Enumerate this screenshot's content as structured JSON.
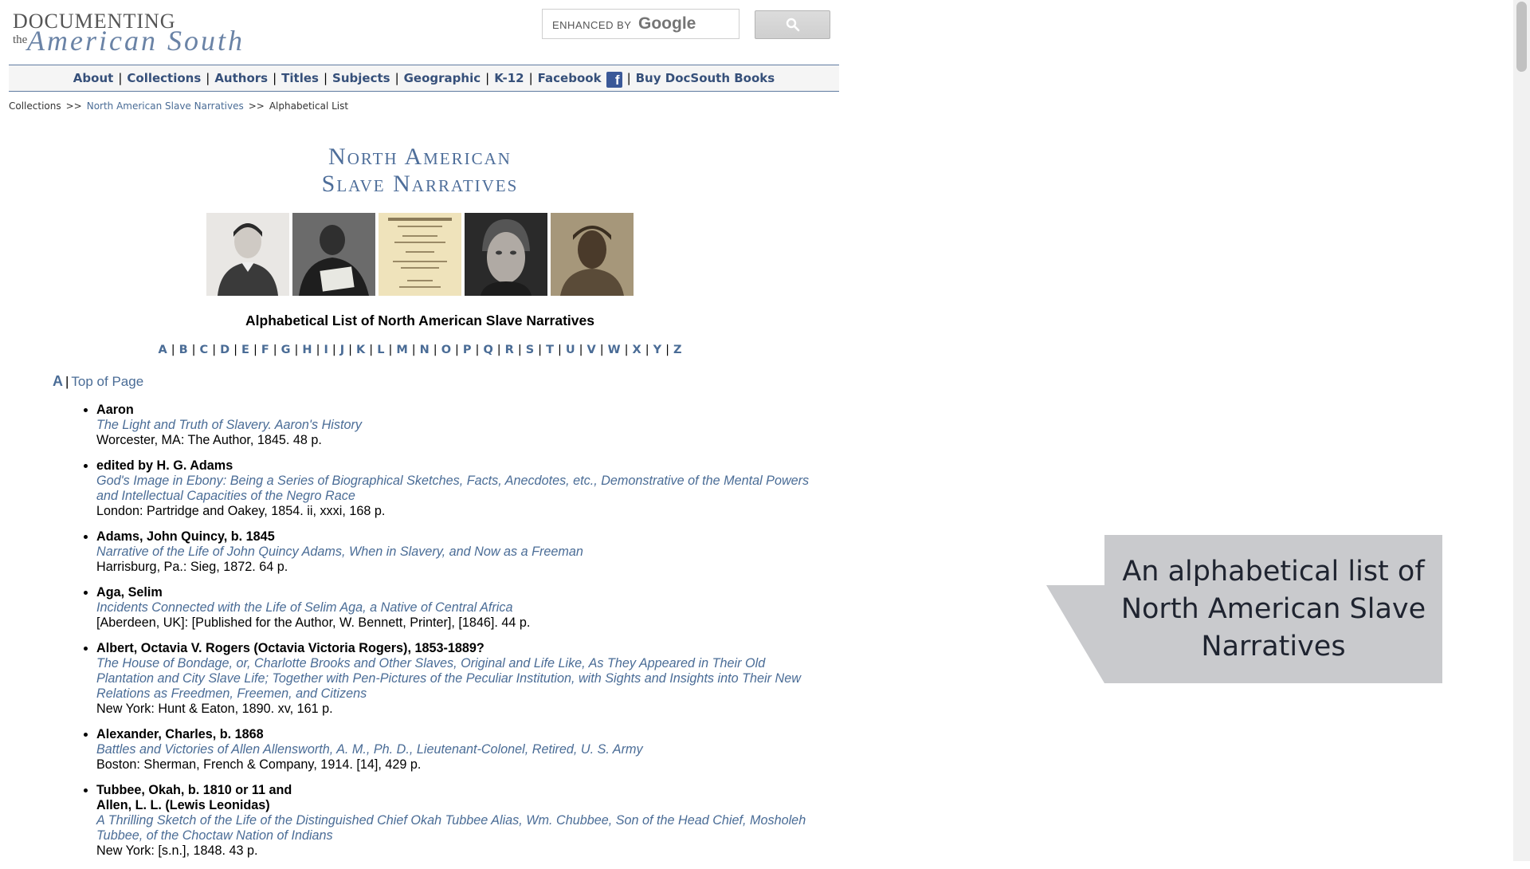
{
  "header": {
    "logo": {
      "top": "DOCUMENTING",
      "the": "the",
      "bottom": "American South"
    },
    "search": {
      "enhanced_label": "ENHANCED BY",
      "google_label": "Google",
      "button_icon": "search-icon"
    }
  },
  "nav": {
    "items": [
      {
        "label": "About"
      },
      {
        "label": "Collections"
      },
      {
        "label": "Authors"
      },
      {
        "label": "Titles"
      },
      {
        "label": "Subjects"
      },
      {
        "label": "Geographic"
      },
      {
        "label": "K-12"
      },
      {
        "label": "Facebook"
      },
      {
        "label": "Buy DocSouth Books"
      }
    ],
    "facebook_icon": "facebook-icon",
    "facebook_glyph": "f"
  },
  "breadcrumb": {
    "items": [
      "Collections",
      "North American Slave Narratives",
      "Alphabetical List"
    ],
    "separator": ">>"
  },
  "collection": {
    "title_line1": "North American",
    "title_line2": "Slave Narratives"
  },
  "list_heading": "Alphabetical List of North American Slave Narratives",
  "alpha_nav": [
    "A",
    "B",
    "C",
    "D",
    "E",
    "F",
    "G",
    "H",
    "I",
    "J",
    "K",
    "L",
    "M",
    "N",
    "O",
    "P",
    "Q",
    "R",
    "S",
    "T",
    "U",
    "V",
    "W",
    "X",
    "Y",
    "Z"
  ],
  "section": {
    "letter": "A",
    "separator": "|",
    "top_link": "Top of Page"
  },
  "entries": [
    {
      "author": "Aaron",
      "title": "The Light and Truth of Slavery. Aaron's History",
      "imprint": "Worcester, MA: The Author, 1845. 48 p."
    },
    {
      "author": "edited by H. G. Adams",
      "title": "God's Image in Ebony: Being a Series of Biographical Sketches, Facts, Anecdotes, etc., Demonstrative of the Mental Powers and Intellectual Capacities of the Negro Race",
      "imprint": "London: Partridge and Oakey, 1854. ii, xxxi, 168 p."
    },
    {
      "author": "Adams, John Quincy, b. 1845",
      "title": "Narrative of the Life of John Quincy Adams, When in Slavery, and Now as a Freeman",
      "imprint": "Harrisburg, Pa.: Sieg, 1872. 64 p."
    },
    {
      "author": "Aga, Selim",
      "title": "Incidents Connected with the Life of Selim Aga, a Native of Central Africa",
      "imprint": "[Aberdeen, UK]: [Published for the Author, W. Bennett, Printer], [1846]. 44 p."
    },
    {
      "author": "Albert, Octavia V. Rogers (Octavia Victoria Rogers), 1853-1889?",
      "title": "The House of Bondage, or, Charlotte Brooks and Other Slaves, Original and Life Like, As They Appeared in Their Old Plantation and City Slave Life; Together with Pen-Pictures of the Peculiar Institution, with Sights and Insights into Their New Relations as Freedmen, Freemen, and Citizens",
      "imprint": "New York: Hunt & Eaton, 1890. xv, 161 p."
    },
    {
      "author": "Alexander, Charles, b. 1868",
      "title": "Battles and Victories of Allen Allensworth, A. M., Ph. D., Lieutenant-Colonel, Retired, U. S. Army",
      "imprint": "Boston: Sherman, French & Company, 1914. [14], 429 p."
    },
    {
      "author": "Tubbee, Okah, b. 1810 or 11 and",
      "author2": "Allen, L. L. (Lewis Leonidas)",
      "title": "A Thrilling Sketch of the Life of the Distinguished Chief Okah Tubbee Alias, Wm. Chubbee, Son of the Head Chief, Mosholeh Tubbee, of the Choctaw Nation of Indians",
      "imprint": "New York: [s.n.], 1848. 43 p."
    }
  ],
  "callout": {
    "text": "An alphabetical list of North American Slave Narratives"
  },
  "colors": {
    "link": "#4a6c96",
    "nav_link": "#36507a",
    "callout_bg": "#c9cacd",
    "facebook": "#3b5998"
  }
}
